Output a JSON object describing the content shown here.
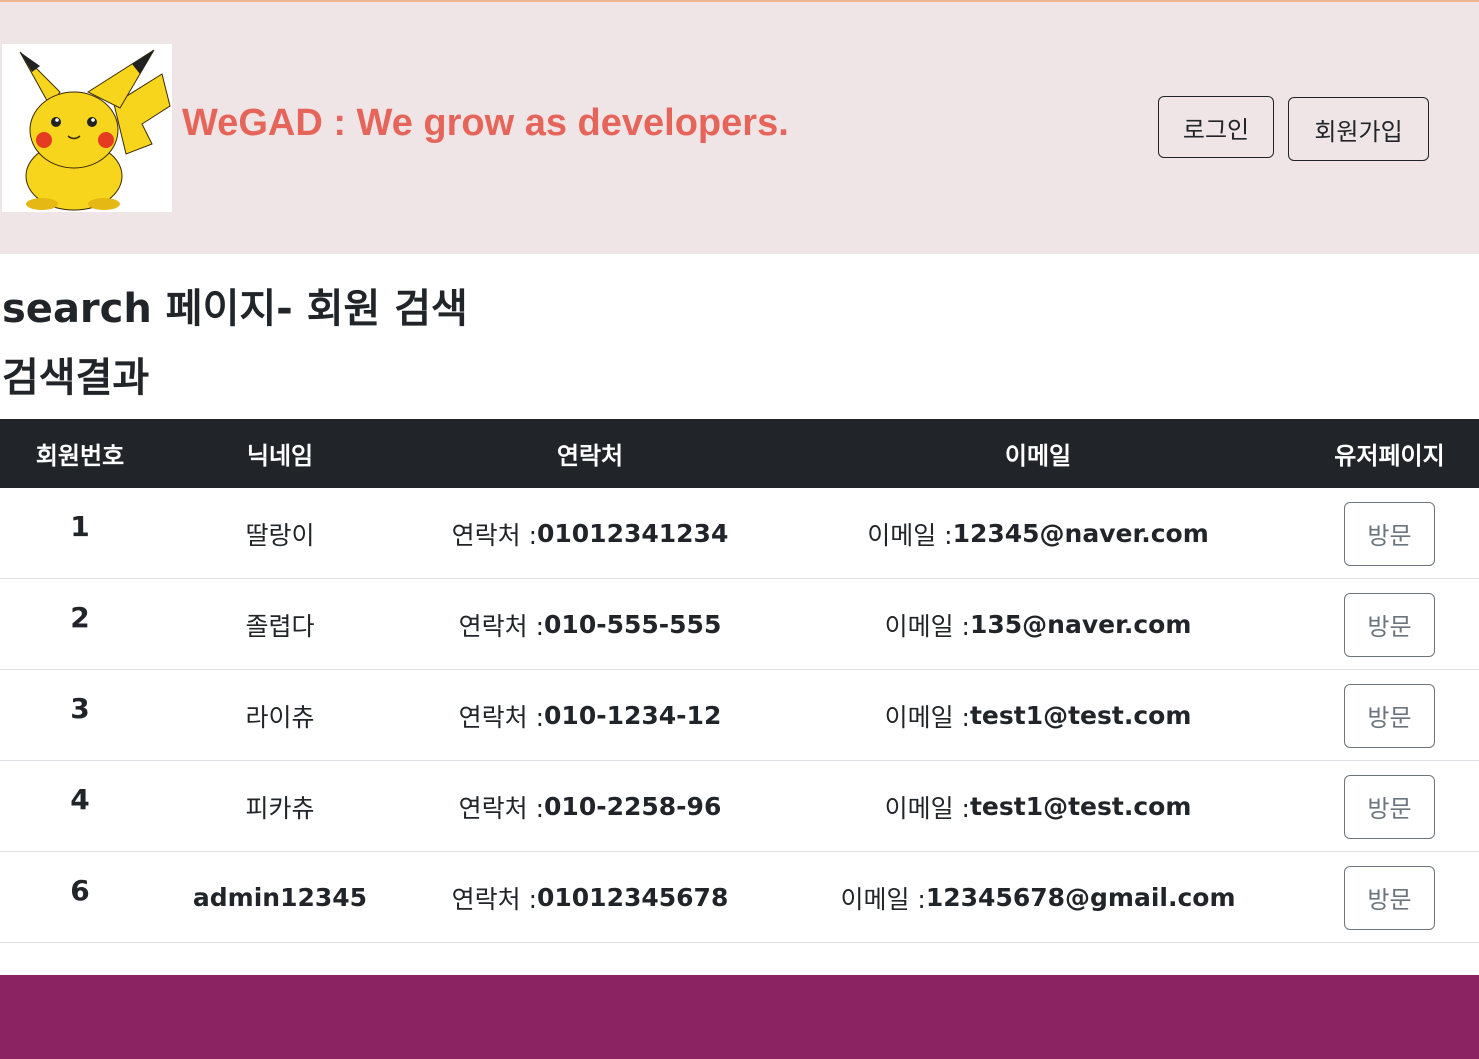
{
  "header": {
    "logo_icon": "pikachu-logo",
    "brand": "WeGAD : We grow as developers.",
    "brand_color": "#e6655a",
    "background": "#efe5e6",
    "login_label": "로그인",
    "signup_label": "회원가입"
  },
  "page": {
    "title": "search 페이지- 회원 검색",
    "subtitle": "검색결과"
  },
  "table": {
    "headers": [
      "회원번호",
      "닉네임",
      "연락처",
      "이메일",
      "유저페이지"
    ],
    "contact_prefix": "연락처 : ",
    "email_prefix": "이메일 : ",
    "visit_label": "방문",
    "rows": [
      {
        "id": "1",
        "nickname": "딸랑이",
        "contact": "01012341234",
        "email": "12345@naver.com"
      },
      {
        "id": "2",
        "nickname": "졸렵다",
        "contact": "010-555-555",
        "email": "135@naver.com"
      },
      {
        "id": "3",
        "nickname": "라이츄",
        "contact": "010-1234-12",
        "email": "test1@test.com"
      },
      {
        "id": "4",
        "nickname": "피카츄",
        "contact": "010-2258-96",
        "email": "test1@test.com"
      },
      {
        "id": "6",
        "nickname": "admin12345",
        "contact": "01012345678",
        "email": "12345678@gmail.com"
      }
    ]
  },
  "footer": {
    "background": "#8b2262"
  }
}
